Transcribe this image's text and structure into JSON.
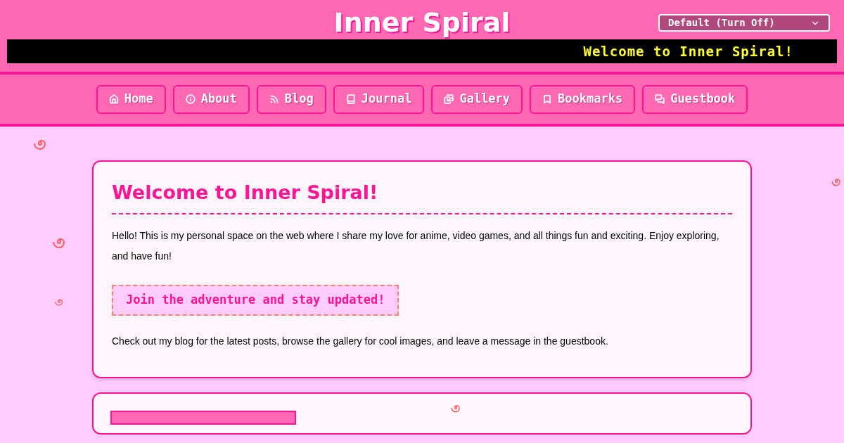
{
  "header": {
    "title": "Inner Spiral",
    "theme_select": {
      "value": "Default (Turn Off)"
    },
    "ticker": "Welcome to Inner Spiral!"
  },
  "nav": [
    {
      "label": "Home",
      "kind": "home"
    },
    {
      "label": "About",
      "kind": "info"
    },
    {
      "label": "Blog",
      "kind": "feed"
    },
    {
      "label": "Journal",
      "kind": "journal"
    },
    {
      "label": "Gallery",
      "kind": "gallery"
    },
    {
      "label": "Bookmarks",
      "kind": "bookmarks"
    },
    {
      "label": "Guestbook",
      "kind": "guestbook"
    }
  ],
  "welcome_card": {
    "heading": "Welcome to Inner Spiral!",
    "intro": "Hello! This is my personal space on the web where I share my love for anime, video games, and all things fun and exciting. Enjoy exploring, and have fun!",
    "callout": "Join the adventure and stay updated!",
    "outro": "Check out my blog for the latest posts, browse the gallery for cool images, and leave a message in the guestbook."
  }
}
